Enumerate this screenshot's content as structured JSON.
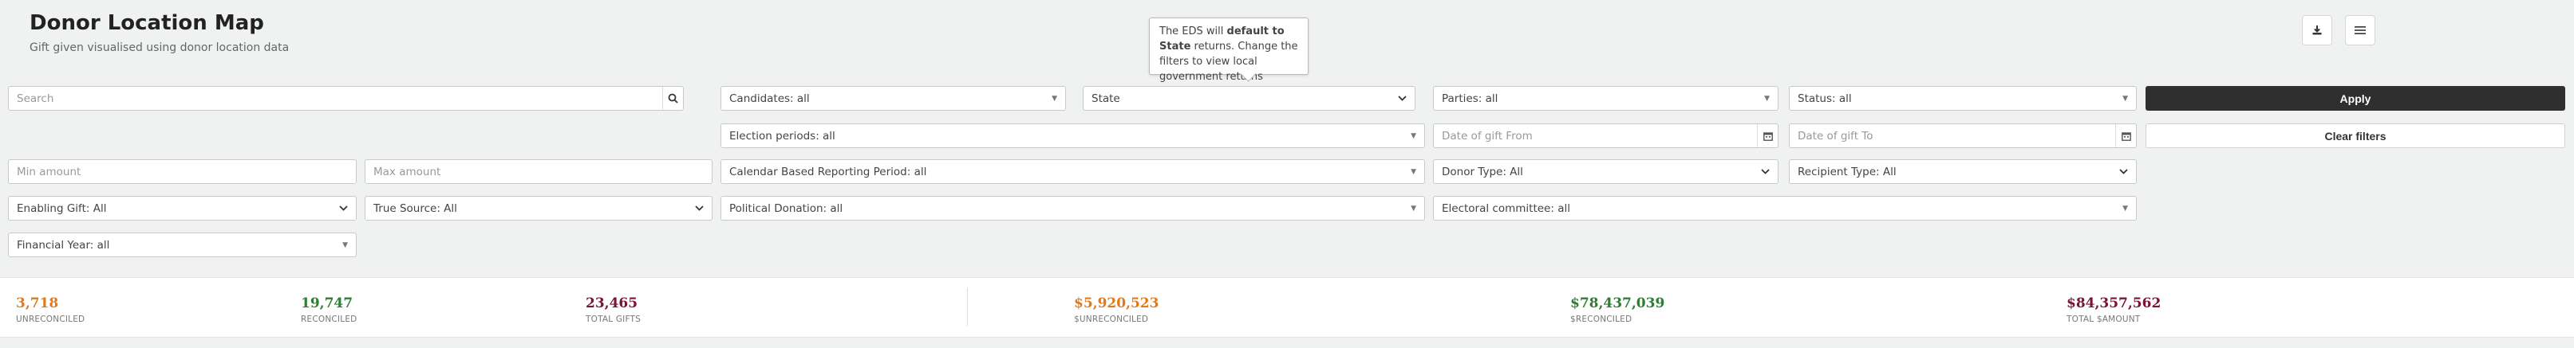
{
  "header": {
    "title": "Donor Location Map",
    "subtitle": "Gift given visualised using donor location data",
    "download_icon": "download-icon",
    "list_icon": "list-settings-icon"
  },
  "tooltip": {
    "pre": "The EDS will ",
    "bold": "default to State",
    "post": " returns. Change the filters to view local government returns"
  },
  "filters": {
    "search_placeholder": "Search",
    "candidates": "Candidates: all",
    "level": "State",
    "parties": "Parties: all",
    "status": "Status: all",
    "apply": "Apply",
    "election_periods": "Election periods: all",
    "date_from_placeholder": "Date of gift From",
    "date_to_placeholder": "Date of gift To",
    "clear": "Clear filters",
    "min_amount_placeholder": "Min amount",
    "max_amount_placeholder": "Max amount",
    "reporting_period": "Calendar Based Reporting Period: all",
    "donor_type": "Donor Type: All",
    "recipient_type": "Recipient Type: All",
    "enabling_gift": "Enabling Gift: All",
    "true_source": "True Source: All",
    "political_donation": "Political Donation: all",
    "electoral_committee": "Electoral committee: all",
    "financial_year": "Financial Year: all"
  },
  "stats": {
    "unreconciled": {
      "value": "3,718",
      "label": "UNRECONCILED",
      "color": "#e07b1c"
    },
    "reconciled": {
      "value": "19,747",
      "label": "RECONCILED",
      "color": "#2e7d32"
    },
    "total_gifts": {
      "value": "23,465",
      "label": "TOTAL GIFTS",
      "color": "#7b1333"
    },
    "unreconciled_amount": {
      "value": "$5,920,523",
      "label": "$UNRECONCILED",
      "color": "#e07b1c"
    },
    "reconciled_amount": {
      "value": "$78,437,039",
      "label": "$RECONCILED",
      "color": "#2e7d32"
    },
    "total_amount": {
      "value": "$84,357,562",
      "label": "TOTAL $AMOUNT",
      "color": "#7b1333"
    }
  }
}
